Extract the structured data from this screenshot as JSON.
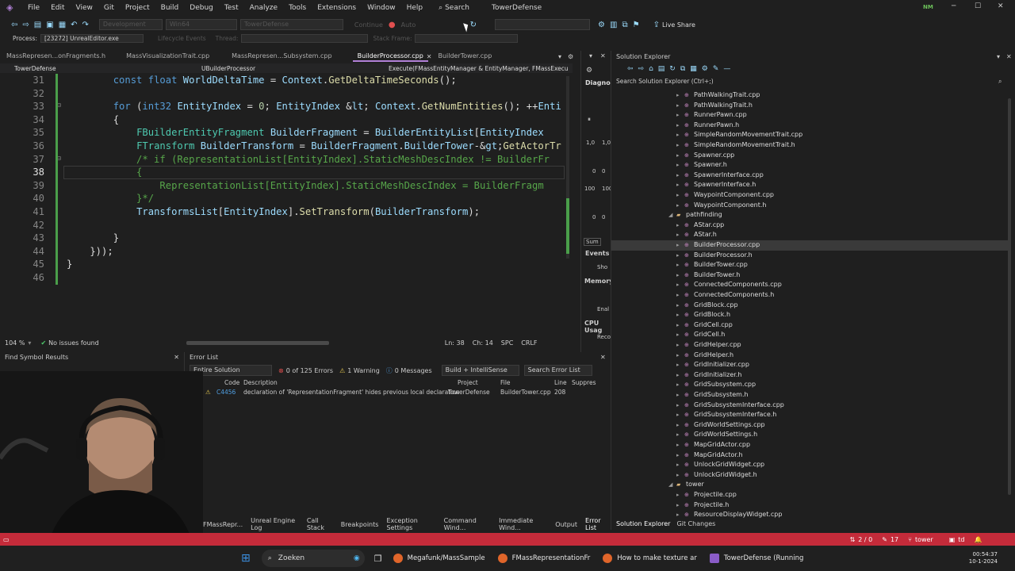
{
  "menu": {
    "items": [
      "File",
      "Edit",
      "View",
      "Git",
      "Project",
      "Build",
      "Debug",
      "Test",
      "Analyze",
      "Tools",
      "Extensions",
      "Window",
      "Help"
    ],
    "search": "Search",
    "solution_name": "TowerDefense",
    "user_initials": "NM"
  },
  "toolbar": {
    "process_label": "Process:",
    "process_value": "[23272] UnrealEditor.exe",
    "lifecycle": "Lifecycle Events",
    "thread": "Thread:",
    "stack_frame": "Stack Frame:",
    "config": "Development",
    "platform": "Win64",
    "target": "TowerDefense",
    "continue": "Continue",
    "auto": "Auto",
    "live_share": "Live Share"
  },
  "doc_tabs": [
    {
      "label": "MassRepresen...onFragments.h",
      "active": false
    },
    {
      "label": "MassVisualizationTrait.cpp",
      "active": false
    },
    {
      "label": "MassRepresen...Subsystem.cpp",
      "active": false
    },
    {
      "label": "BuilderProcessor.cpp",
      "active": true
    },
    {
      "label": "BuilderTower.cpp",
      "active": false
    }
  ],
  "nav": {
    "project": "TowerDefense",
    "class": "UBuilderProcessor",
    "member": "Execute(FMassEntityManager & EntityManager, FMassExecu"
  },
  "code_lines": [
    {
      "n": "31",
      "t": "        const float WorldDeltaTime = Context.GetDeltaTimeSeconds();"
    },
    {
      "n": "32",
      "t": ""
    },
    {
      "n": "33",
      "t": "        for (int32 EntityIndex = 0; EntityIndex < Context.GetNumEntities(); ++Enti"
    },
    {
      "n": "34",
      "t": "        {"
    },
    {
      "n": "35",
      "t": "            FBuilderEntityFragment BuilderFragment = BuilderEntityList[EntityIndex"
    },
    {
      "n": "36",
      "t": "            FTransform BuilderTransform = BuilderFragment.BuilderTower->GetActorTr"
    },
    {
      "n": "37",
      "t": "            /* if (RepresentationList[EntityIndex].StaticMeshDescIndex != BuilderFr"
    },
    {
      "n": "38",
      "t": "            {"
    },
    {
      "n": "39",
      "t": "                RepresentationList[EntityIndex].StaticMeshDescIndex = BuilderFragm"
    },
    {
      "n": "40",
      "t": "            }*/"
    },
    {
      "n": "41",
      "t": "            TransformsList[EntityIndex].SetTransform(BuilderTransform);"
    },
    {
      "n": "42",
      "t": ""
    },
    {
      "n": "43",
      "t": "        }"
    },
    {
      "n": "44",
      "t": "    }));"
    },
    {
      "n": "45",
      "t": "}"
    },
    {
      "n": "46",
      "t": ""
    }
  ],
  "editor_status": {
    "zoom": "104 %",
    "issues": "No issues found",
    "position": "Ln: 38",
    "col": "Ch: 14",
    "spc": "SPC",
    "eol": "CRLF"
  },
  "diag": {
    "title": "Diagnost",
    "values": [
      "1,0",
      "1,0",
      "0",
      "0",
      "100",
      "100",
      "0",
      "0"
    ],
    "summary_tab": "Sum",
    "events": "Events",
    "show": "Sho",
    "memory": "Memory",
    "enable": "Enal",
    "cpu": "CPU Usag",
    "record": "Reco"
  },
  "find_symbol": {
    "title": "Find Symbol Results"
  },
  "error_list": {
    "title": "Error List",
    "scope": "Entire Solution",
    "errors": "0 of 125 Errors",
    "warnings": "1 Warning",
    "messages": "0 Messages",
    "filter": "Build + IntelliSense",
    "search": "Search Error List",
    "columns": [
      "Code",
      "Description",
      "Project",
      "File",
      "Line",
      "Suppres"
    ],
    "rows": [
      {
        "code": "C4456",
        "desc": "declaration of 'RepresentationFragment' hides previous local declaration",
        "project": "TowerDefense",
        "file": "BuilderTower.cpp",
        "line": "208"
      }
    ]
  },
  "bottom_tabs": [
    "FMassRepr...",
    "Unreal Engine Log",
    "Call Stack",
    "Breakpoints",
    "Exception Settings",
    "Command Wind...",
    "Immediate Wind...",
    "Output",
    "Error List"
  ],
  "solution_explorer": {
    "title": "Solution Explorer",
    "search": "Search Solution Explorer (Ctrl+;)",
    "items": [
      {
        "label": "PathWalkingTrait.cpp",
        "type": "file"
      },
      {
        "label": "PathWalkingTrait.h",
        "type": "file"
      },
      {
        "label": "RunnerPawn.cpp",
        "type": "file"
      },
      {
        "label": "RunnerPawn.h",
        "type": "file"
      },
      {
        "label": "SimpleRandomMovementTrait.cpp",
        "type": "file"
      },
      {
        "label": "SimpleRandomMovementTrait.h",
        "type": "file"
      },
      {
        "label": "Spawner.cpp",
        "type": "file"
      },
      {
        "label": "Spawner.h",
        "type": "file"
      },
      {
        "label": "SpawnerInterface.cpp",
        "type": "file"
      },
      {
        "label": "SpawnerInterface.h",
        "type": "file"
      },
      {
        "label": "WaypointComponent.cpp",
        "type": "file"
      },
      {
        "label": "WaypointComponent.h",
        "type": "file"
      },
      {
        "label": "pathfinding",
        "type": "folder"
      },
      {
        "label": "AStar.cpp",
        "type": "file"
      },
      {
        "label": "AStar.h",
        "type": "file"
      },
      {
        "label": "BuilderProcessor.cpp",
        "type": "file",
        "selected": true
      },
      {
        "label": "BuilderProcessor.h",
        "type": "file"
      },
      {
        "label": "BuilderTower.cpp",
        "type": "file"
      },
      {
        "label": "BuilderTower.h",
        "type": "file"
      },
      {
        "label": "ConnectedComponents.cpp",
        "type": "file"
      },
      {
        "label": "ConnectedComponents.h",
        "type": "file"
      },
      {
        "label": "GridBlock.cpp",
        "type": "file"
      },
      {
        "label": "GridBlock.h",
        "type": "file"
      },
      {
        "label": "GridCell.cpp",
        "type": "file"
      },
      {
        "label": "GridCell.h",
        "type": "file"
      },
      {
        "label": "GridHelper.cpp",
        "type": "file"
      },
      {
        "label": "GridHelper.h",
        "type": "file"
      },
      {
        "label": "GridInitializer.cpp",
        "type": "file"
      },
      {
        "label": "GridInitializer.h",
        "type": "file"
      },
      {
        "label": "GridSubsystem.cpp",
        "type": "file"
      },
      {
        "label": "GridSubsystem.h",
        "type": "file"
      },
      {
        "label": "GridSubsystemInterface.cpp",
        "type": "file"
      },
      {
        "label": "GridSubsystemInterface.h",
        "type": "file"
      },
      {
        "label": "GridWorldSettings.cpp",
        "type": "file"
      },
      {
        "label": "GridWorldSettings.h",
        "type": "file"
      },
      {
        "label": "MapGridActor.cpp",
        "type": "file"
      },
      {
        "label": "MapGridActor.h",
        "type": "file"
      },
      {
        "label": "UnlockGridWidget.cpp",
        "type": "file"
      },
      {
        "label": "UnlockGridWidget.h",
        "type": "file"
      },
      {
        "label": "tower",
        "type": "folder"
      },
      {
        "label": "Projectile.cpp",
        "type": "file"
      },
      {
        "label": "Projectile.h",
        "type": "file"
      },
      {
        "label": "ResourceDisplayWidget.cpp",
        "type": "file"
      }
    ],
    "bottom_tabs": [
      "Solution Explorer",
      "Git Changes"
    ]
  },
  "vs_status": {
    "git_count": "2 / 0",
    "edits": "17",
    "branch": "tower",
    "repo": "td"
  },
  "taskbar": {
    "search": "Zoeken",
    "apps": [
      "Megafunk/MassSample",
      "FMassRepresentationFr",
      "How to make texture ar",
      "TowerDefense (Running"
    ],
    "time": "00:54:37",
    "date": "10-1-2024"
  },
  "colors": {
    "accent": "#b180d7",
    "statusbar": "#c42b3a",
    "selection": "#3a3a3a"
  }
}
